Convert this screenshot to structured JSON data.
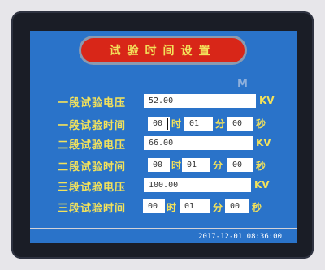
{
  "title": "试验时间设置",
  "watermark": "M",
  "rows": [
    {
      "label": "一段试验电压",
      "value": "52.00",
      "unit": "KV"
    },
    {
      "label": "一段试验时间",
      "hh": "00",
      "h_unit": "时",
      "mm": "01",
      "m_unit": "分",
      "ss": "00",
      "s_unit": "秒"
    },
    {
      "label": "二段试验电压",
      "value": "66.00",
      "unit": "KV"
    },
    {
      "label": "二段试验时间",
      "hh": "00",
      "h_unit": "时",
      "mm": "01",
      "m_unit": "分",
      "ss": "00",
      "s_unit": "秒"
    },
    {
      "label": "三段试验电压",
      "value": "100.00",
      "unit": "KV"
    },
    {
      "label": "三段试验时间",
      "hh": "00",
      "h_unit": "时",
      "mm": "01",
      "m_unit": "分",
      "ss": "00",
      "s_unit": "秒"
    }
  ],
  "status": {
    "datetime": "2017-12-01 08:36:00"
  }
}
